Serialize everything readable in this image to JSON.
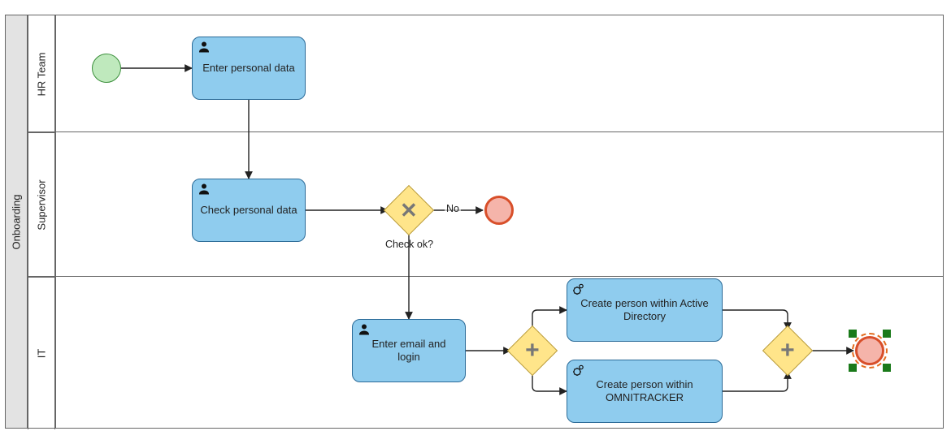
{
  "pool": {
    "name": "Onboarding"
  },
  "lanes": [
    {
      "name": "HR Team"
    },
    {
      "name": "Supervisor"
    },
    {
      "name": "IT"
    }
  ],
  "tasks": {
    "enter_personal_data": {
      "label": "Enter personal data",
      "type": "user"
    },
    "check_personal_data": {
      "label": "Check personal data",
      "type": "user"
    },
    "enter_email_login": {
      "label": "Enter email and login",
      "type": "user"
    },
    "create_ad": {
      "label": "Create person within Active Directory",
      "type": "service"
    },
    "create_omni": {
      "label": "Create person within OMNITRACKER",
      "type": "service"
    }
  },
  "gateways": {
    "exclusive_check": {
      "type": "exclusive",
      "label": "Check ok?",
      "mark": "✕"
    },
    "parallel_split": {
      "type": "parallel",
      "mark": "+"
    },
    "parallel_join": {
      "type": "parallel",
      "mark": "+"
    }
  },
  "flows": {
    "check_no": {
      "label": "No"
    }
  },
  "colors": {
    "task_fill": "#8fccee",
    "task_border": "#2b6b98",
    "gateway_fill": "#ffe58a",
    "gateway_border": "#b89b3e",
    "start_fill": "#bfe9bd",
    "start_border": "#3b8f3b",
    "end_fill": "#f5b4aa",
    "end_border": "#d84f2a",
    "selection": "#e36c1f",
    "handle": "#1a7a1a"
  }
}
